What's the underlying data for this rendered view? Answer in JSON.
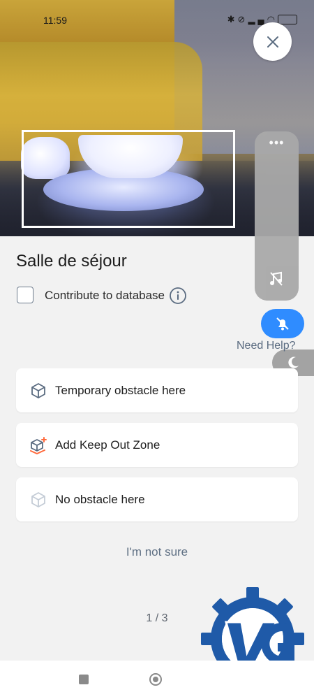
{
  "status_bar": {
    "time": "11:59"
  },
  "room": {
    "title": "Salle de séjour"
  },
  "contribute": {
    "label": "Contribute to database",
    "checked": false
  },
  "help": {
    "label": "Need Help?"
  },
  "options": [
    {
      "label": "Temporary obstacle here",
      "icon": "cube-icon"
    },
    {
      "label": "Add Keep Out Zone",
      "icon": "keep-out-zone-icon"
    },
    {
      "label": "No obstacle here",
      "icon": "cube-outline-icon"
    }
  ],
  "not_sure": {
    "label": "I'm not sure"
  },
  "pager": {
    "text": "1 / 3"
  },
  "colors": {
    "accent": "#2f8cff",
    "keep_out_accent": "#ff6a3d",
    "muted_text": "#5f7084",
    "watermark_blue": "#1f5aa8"
  }
}
